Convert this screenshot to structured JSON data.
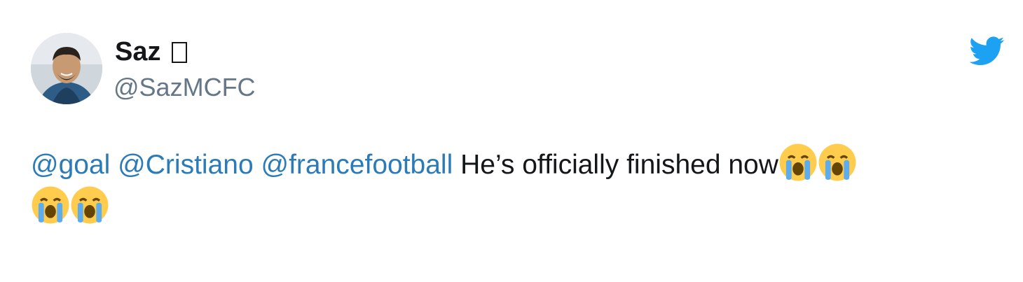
{
  "user": {
    "display_name": "Saz",
    "handle": "@SazMCFC"
  },
  "tweet": {
    "mentions": [
      "@goal",
      "@Cristiano",
      "@francefootball"
    ],
    "text": "He’s officially finished now",
    "emojis": [
      "loudly-crying-face-emoji",
      "loudly-crying-face-emoji",
      "loudly-crying-face-emoji",
      "loudly-crying-face-emoji"
    ]
  },
  "icons": {
    "brand": "twitter-bird-icon",
    "brand_color": "#1da1f2"
  },
  "colors": {
    "mention": "#2b7bb9",
    "text": "#14171a",
    "handle": "#657786"
  }
}
